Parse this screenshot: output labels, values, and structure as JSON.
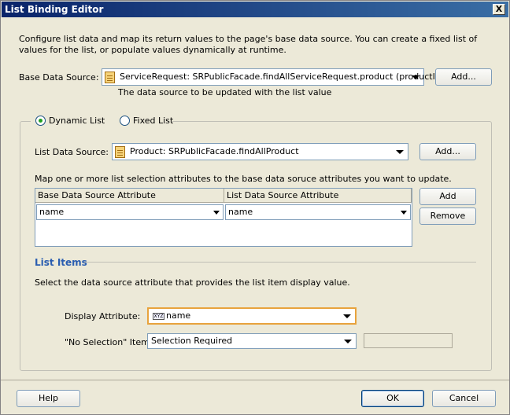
{
  "window": {
    "title": "List Binding Editor",
    "close_label": "X"
  },
  "intro_text": "Configure list data and map its return values to the page's base data source. You can create a fixed list of values for the list, or populate values dynamically at runtime.",
  "base_data_source": {
    "label": "Base Data Source:",
    "value": "ServiceRequest:  SRPublicFacade.findAllServiceRequest.product (productI...",
    "add_label": "Add...",
    "hint": "The data source to be updated with the list value"
  },
  "mode": {
    "dynamic_label": "Dynamic List",
    "fixed_label": "Fixed List",
    "selected": "dynamic"
  },
  "list_data_source": {
    "label": "List Data Source:",
    "value": "Product:  SRPublicFacade.findAllProduct",
    "add_label": "Add..."
  },
  "mapping": {
    "instruction": "Map one or more list selection attributes to the base data soruce attributes you want to update.",
    "columns": [
      "Base Data Source Attribute",
      "List Data Source Attribute"
    ],
    "rows": [
      {
        "base": "name",
        "list": "name"
      }
    ],
    "add_label": "Add",
    "remove_label": "Remove"
  },
  "list_items": {
    "heading": "List Items",
    "instruction": "Select the data source attribute that provides the list item display value.",
    "display_attribute_label": "Display Attribute:",
    "display_attribute_value": "name",
    "display_attribute_icon": "XYZ",
    "no_selection_label": "\"No Selection\" Item:",
    "no_selection_value": "Selection Required",
    "no_selection_text": ""
  },
  "footer": {
    "help_label": "Help",
    "ok_label": "OK",
    "cancel_label": "Cancel"
  },
  "colors": {
    "title_bar": "#0a246a",
    "dialog_bg": "#ece9d8",
    "section_heading": "#2a5db0",
    "highlight_border": "#e8a33d"
  }
}
